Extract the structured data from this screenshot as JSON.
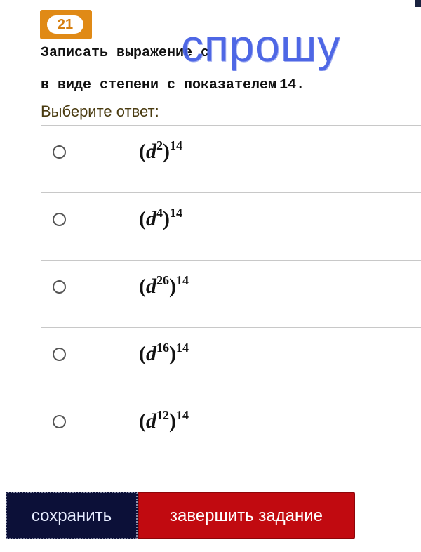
{
  "question": {
    "number": "21",
    "line1": "Записать выражение c",
    "line2": "в виде степени с показателем",
    "exponent": "14."
  },
  "overlay_text": "спрошу",
  "prompt": "Выберите ответ:",
  "options": [
    {
      "base": "d",
      "inner_exp": "2",
      "outer_exp": "14"
    },
    {
      "base": "d",
      "inner_exp": "4",
      "outer_exp": "14"
    },
    {
      "base": "d",
      "inner_exp": "26",
      "outer_exp": "14"
    },
    {
      "base": "d",
      "inner_exp": "16",
      "outer_exp": "14"
    },
    {
      "base": "d",
      "inner_exp": "12",
      "outer_exp": "14"
    }
  ],
  "buttons": {
    "save": "сохранить",
    "finish": "завершить задание"
  },
  "colors": {
    "badge": "#e08a16",
    "watermark": "#3f5be3",
    "save_button": "#0c1038",
    "finish_button": "#c10a10"
  }
}
